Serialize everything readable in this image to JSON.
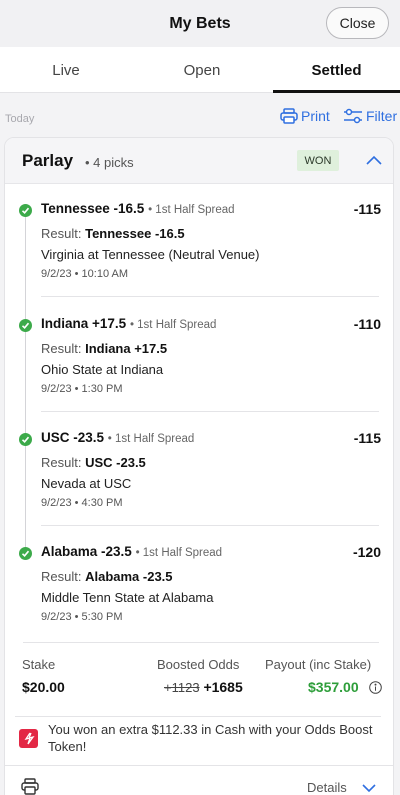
{
  "header": {
    "title": "My Bets",
    "close_label": "Close"
  },
  "tabs": [
    {
      "label": "Live",
      "active": false
    },
    {
      "label": "Open",
      "active": false
    },
    {
      "label": "Settled",
      "active": true
    }
  ],
  "toolbar": {
    "section_label": "Today",
    "print_label": "Print",
    "filter_label": "Filter"
  },
  "bet": {
    "title": "Parlay",
    "picks": "• 4 picks",
    "status": "WON",
    "legs": [
      {
        "pick": "Tennessee -16.5",
        "type": "• 1st Half Spread",
        "odds": "-115",
        "result_label": "Result:",
        "result": "Tennessee -16.5",
        "matchup": "Virginia at Tennessee (Neutral Venue)",
        "time": "9/2/23 • 10:10 AM"
      },
      {
        "pick": "Indiana +17.5",
        "type": "• 1st Half Spread",
        "odds": "-110",
        "result_label": "Result:",
        "result": "Indiana +17.5",
        "matchup": "Ohio State at Indiana",
        "time": "9/2/23 • 1:30 PM"
      },
      {
        "pick": "USC -23.5",
        "type": "• 1st Half Spread",
        "odds": "-115",
        "result_label": "Result:",
        "result": "USC -23.5",
        "matchup": "Nevada at USC",
        "time": "9/2/23 • 4:30 PM"
      },
      {
        "pick": "Alabama -23.5",
        "type": "• 1st Half Spread",
        "odds": "-120",
        "result_label": "Result:",
        "result": "Alabama -23.5",
        "matchup": "Middle Tenn State at Alabama",
        "time": "9/2/23 • 5:30 PM"
      }
    ],
    "stake_label": "Stake",
    "stake": "$20.00",
    "boosted_label": "Boosted Odds",
    "original_odds": "+1123",
    "boosted_odds": "+1685",
    "payout_label": "Payout (inc Stake)",
    "payout": "$357.00",
    "boost_message": "You won an extra $112.33 in Cash with your Odds Boost Token!",
    "details_label": "Details"
  },
  "colors": {
    "accent": "#2f6fe0",
    "win_green": "#3caa4a",
    "payout_green": "#2e9e3a",
    "boost_red": "#e32845"
  }
}
